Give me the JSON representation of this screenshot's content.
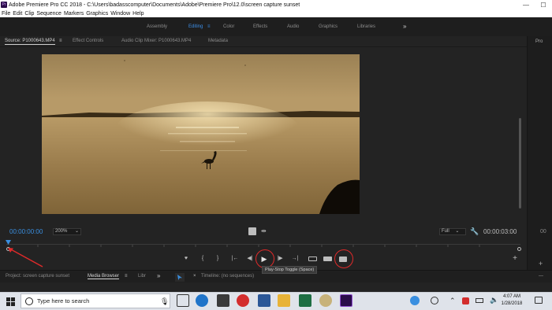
{
  "window": {
    "title": "Adobe Premiere Pro CC 2018 - C:\\Users\\badasscomputer\\Documents\\Adobe\\Premiere Pro\\12.0\\screen capture sunset",
    "logo_text": "Pr",
    "minimize": "—",
    "maximize": "☐"
  },
  "menu": [
    "File",
    "Edit",
    "Clip",
    "Sequence",
    "Markers",
    "Graphics",
    "Window",
    "Help"
  ],
  "workspaces": {
    "items": [
      {
        "label": "Assembly"
      },
      {
        "label": "Editing",
        "menu": "≡"
      },
      {
        "label": "Color"
      },
      {
        "label": "Effects"
      },
      {
        "label": "Audio"
      },
      {
        "label": "Graphics"
      },
      {
        "label": "Libraries"
      }
    ],
    "more": "»"
  },
  "source_panel": {
    "tabs": [
      "Source: P1000643.MP4",
      "Effect Controls",
      "Audio Clip Mixer: P1000643.MP4",
      "Metadata"
    ],
    "tab_menu": "≡",
    "timecode_left": "00:00:00:00",
    "zoom": "200%",
    "quality": "Full",
    "timecode_right": "00:00:03:00"
  },
  "right_panel": {
    "label": "Pro",
    "timecode": "00",
    "dash": "—"
  },
  "transport": {
    "marker": "♥",
    "in": "{",
    "out": "}",
    "go_in": "|←",
    "step_back": "◀|",
    "play": "▶",
    "step_fwd": "|▶",
    "go_out": "→|",
    "add": "+"
  },
  "tooltip": "Play-Stop Toggle (Space)",
  "bottom_panels": {
    "project": "Project: screen capture sunset",
    "media_browser": "Media Browser",
    "menu": "≡",
    "lib": "Libr",
    "more": "»",
    "close": "×",
    "timeline": "Timeline: (no sequences)",
    "dash": "—"
  },
  "taskbar": {
    "search_placeholder": "Type here to search",
    "time": "4:07 AM",
    "date": "1/28/2018"
  },
  "colors": {
    "accent_blue": "#3a8fe0",
    "annotation_red": "#e02a2a",
    "panel_bg": "#232323"
  }
}
